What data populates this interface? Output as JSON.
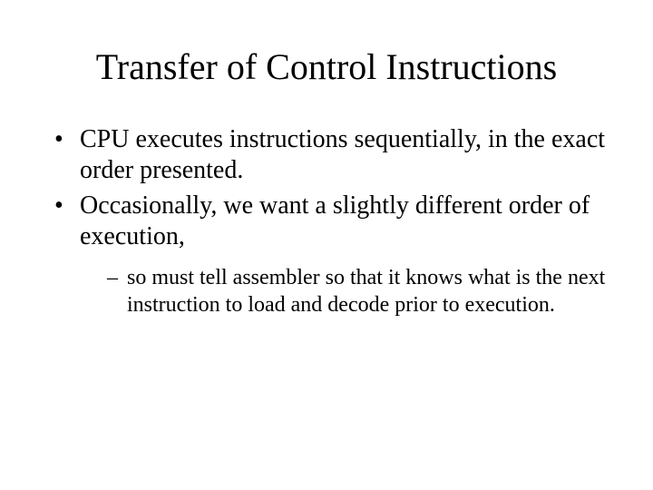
{
  "slide": {
    "title": "Transfer of Control Instructions",
    "bullets": [
      "CPU executes instructions sequentially, in the exact order presented.",
      "Occasionally, we want a slightly different order of execution,"
    ],
    "sub_bullets": [
      "so must tell assembler so that it knows what is the next instruction to load and decode prior to execution."
    ]
  }
}
